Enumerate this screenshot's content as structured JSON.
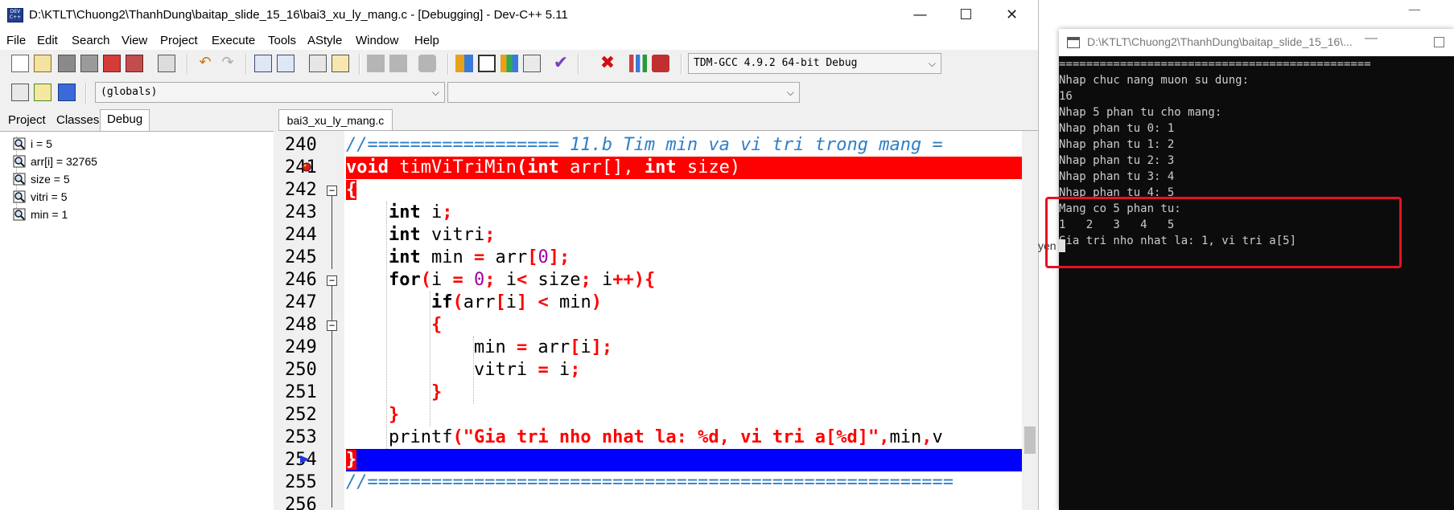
{
  "ide": {
    "title": "D:\\KTLT\\Chuong2\\ThanhDung\\baitap_slide_15_16\\bai3_xu_ly_mang.c - [Debugging] - Dev-C++ 5.11",
    "window_buttons": {
      "minimize": "—",
      "maximize": "☐",
      "close": "✕"
    },
    "menu": [
      "File",
      "Edit",
      "Search",
      "View",
      "Project",
      "Execute",
      "Tools",
      "AStyle",
      "Window",
      "Help"
    ],
    "compiler_select": "TDM-GCC 4.9.2 64-bit Debug",
    "scope_select": "(globals)",
    "function_select": "",
    "left_tabs": [
      "Project",
      "Classes",
      "Debug"
    ],
    "active_left_tab": "Debug",
    "watches": [
      "i = 5",
      "arr[i] = 32765",
      "size = 5",
      "vitri = 5",
      "min = 1"
    ],
    "editor_tab": "bai3_xu_ly_mang.c",
    "line_numbers": [
      "240",
      "241",
      "242",
      "243",
      "244",
      "245",
      "246",
      "247",
      "248",
      "249",
      "250",
      "251",
      "252",
      "253",
      "254",
      "255",
      "256"
    ],
    "code": {
      "l240": "//================== 11.b Tim min va vi tri trong mang =",
      "l241_kw": "void",
      "l241_fn": " timViTriMin",
      "l241_rest_1": "(",
      "l241_kw2": "int",
      "l241_rest_2": " arr[], ",
      "l241_kw3": "int",
      "l241_rest_3": " size)",
      "l242": "{",
      "l243_kw": "int",
      "l243_rest": " i",
      "l244_kw": "int",
      "l244_rest": " vitri",
      "l245_kw": "int",
      "l245_rest": " min ",
      "l245_eq": "=",
      "l245_arr": " arr",
      "l245_num": "0",
      "l246_kw": "for",
      "l246_a": "i ",
      "l246_b": " ",
      "l246_num": "0",
      "l246_c": " i",
      "l246_d": " size",
      "l246_e": " i",
      "l247_kw": "if",
      "l247_a": "arr",
      "l247_b": "i",
      "l247_c": " min",
      "l248": "{",
      "l249_a": "min ",
      "l249_b": " arr",
      "l249_c": "i",
      "l250_a": "vitri ",
      "l250_b": " i",
      "l251": "}",
      "l252": "}",
      "l253_fn": "printf",
      "l253_str": "\"Gia tri nho nhat la: %d, vi tri a[%d]\"",
      "l253_rest": "min",
      "l253_tail": "v",
      "l254": "}",
      "l255": "//======================================================="
    },
    "behind_text": "yen"
  },
  "console": {
    "title": "D:\\KTLT\\Chuong2\\ThanhDung\\baitap_slide_15_16\\...",
    "lines": [
      "==============================================",
      "Nhap chuc nang muon su dung:",
      "16",
      "Nhap 5 phan tu cho mang:",
      "Nhap phan tu 0: 1",
      "Nhap phan tu 1: 2",
      "Nhap phan tu 2: 3",
      "Nhap phan tu 3: 4",
      "Nhap phan tu 4: 5",
      "Mang co 5 phan tu:",
      "1   2   3   4   5",
      "Gia tri nho nhat la: 1, vi tri a[5]"
    ]
  },
  "colors": {
    "breakpoint_line": "#ff0000",
    "execution_line": "#0000ff",
    "highlight_box": "#e81123",
    "console_bg": "#0c0c0c"
  }
}
